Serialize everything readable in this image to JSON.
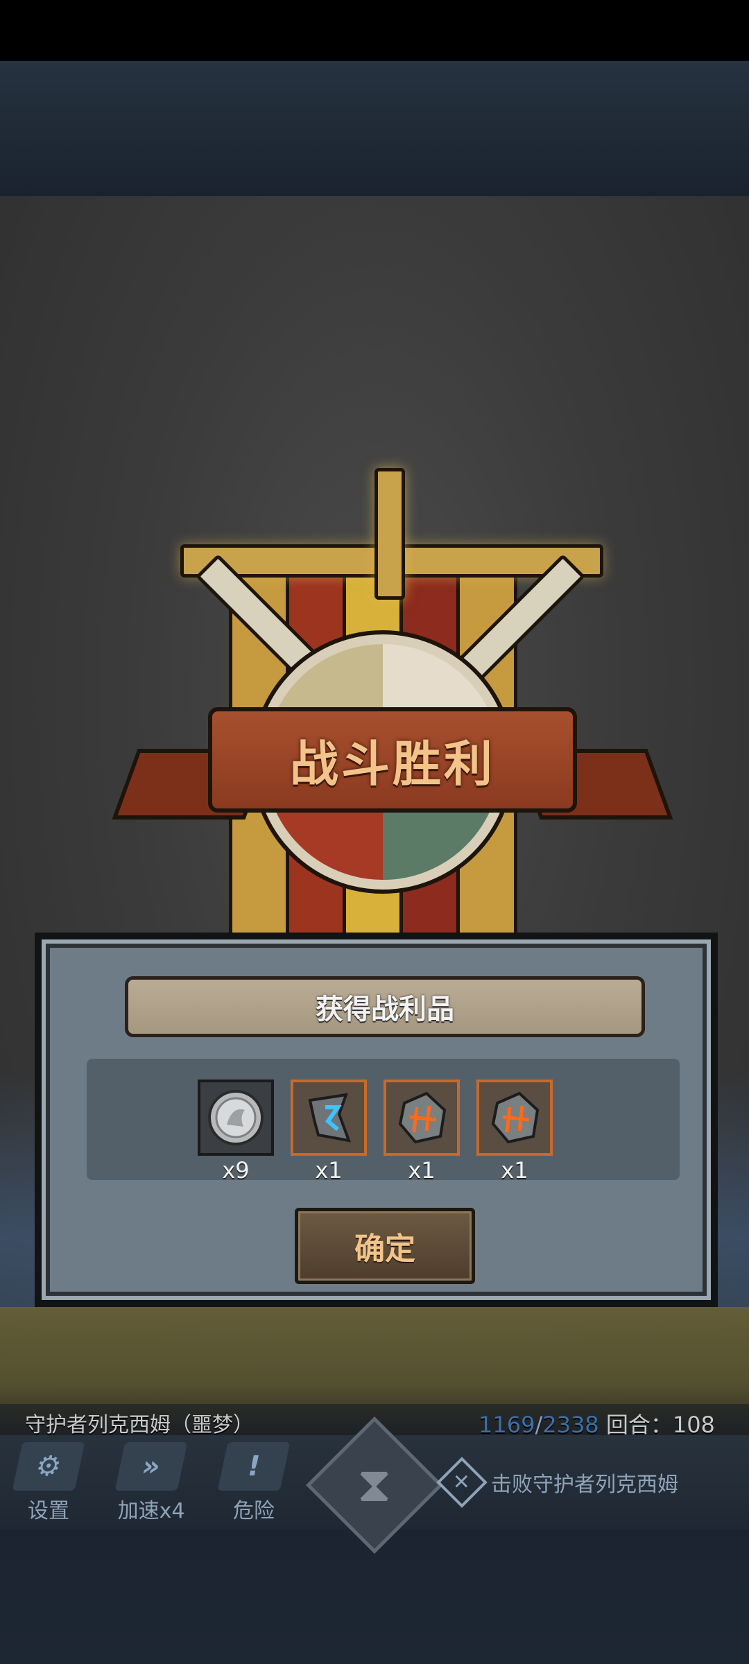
{
  "victory": {
    "title": "战斗胜利"
  },
  "rewards": {
    "header": "获得战利品",
    "items": [
      {
        "icon": "silver-coin-icon",
        "qty": "x9"
      },
      {
        "icon": "blue-rune-shard-icon",
        "qty": "x1"
      },
      {
        "icon": "orange-rune-stone-icon",
        "qty": "x1"
      },
      {
        "icon": "orange-rune-stone-icon",
        "qty": "x1"
      }
    ],
    "confirm_label": "确定"
  },
  "hud": {
    "boss_name": "守护者列克西姆（噩梦）",
    "hp_current": "1169",
    "hp_max": "2338",
    "round_label": "回合：108"
  },
  "controls": [
    {
      "icon": "gear-icon",
      "label": "设置"
    },
    {
      "icon": "fast-forward-icon",
      "label": "加速x4"
    },
    {
      "icon": "exclamation-icon",
      "label": "危险"
    }
  ],
  "objective": {
    "icon": "crossed-swords-icon",
    "text": "击败守护者列克西姆"
  },
  "colors": {
    "title_text": "#f2c48a",
    "item_frame": "#c86a2c",
    "panel_bg": "#6e7c88"
  }
}
